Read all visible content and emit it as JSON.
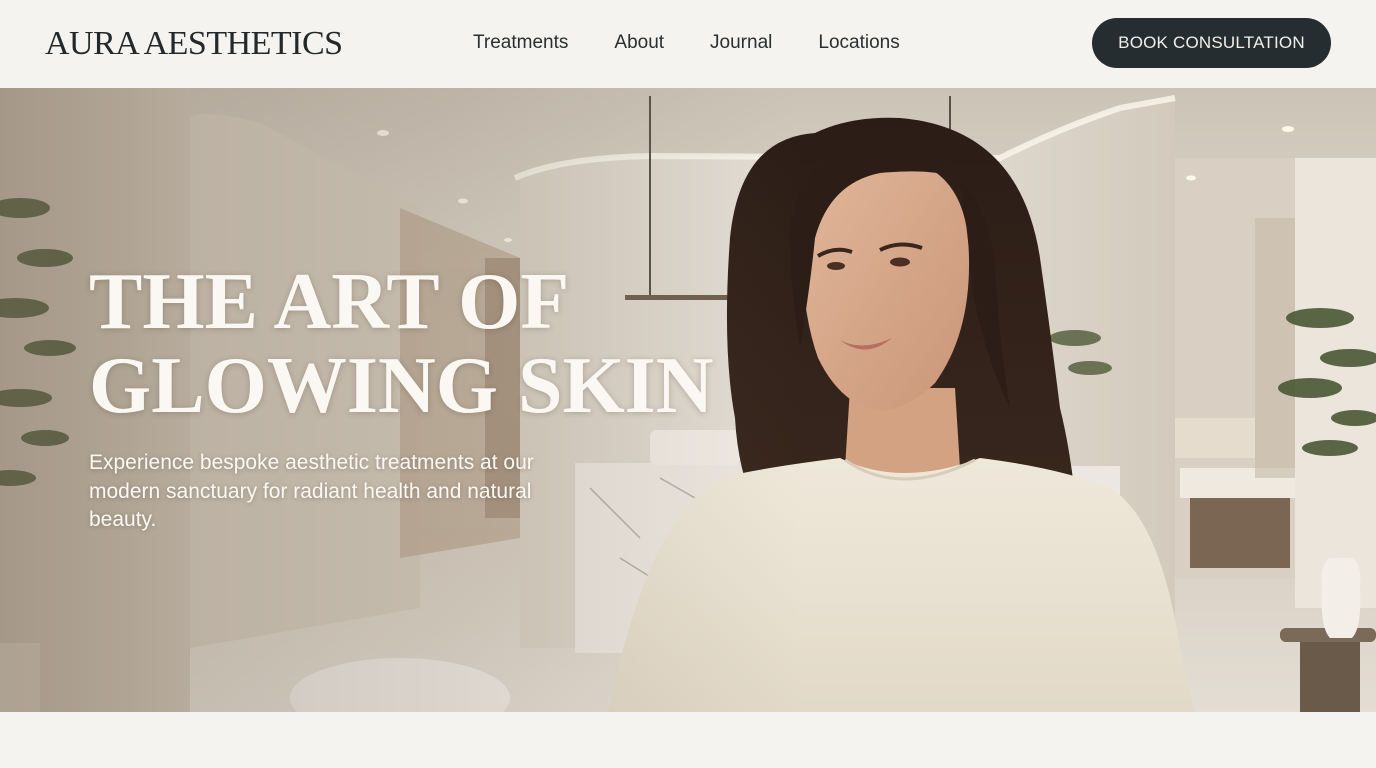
{
  "brand": {
    "logo_text": "AURA AESTHETICS"
  },
  "nav": {
    "items": [
      {
        "label": "Treatments"
      },
      {
        "label": "About"
      },
      {
        "label": "Journal"
      },
      {
        "label": "Locations"
      }
    ]
  },
  "header": {
    "cta_label": "BOOK CONSULTATION"
  },
  "hero": {
    "headline_line1": "THE ART OF",
    "headline_line2": "GLOWING SKIN",
    "subtext": "Experience bespoke aesthetic treatments at our modern sanctuary for radiant health and natural beauty."
  },
  "colors": {
    "page_bg": "#f5f3ef",
    "cta_bg": "#252d30",
    "text_dark": "#23292b",
    "text_light": "#fbf8f3"
  }
}
